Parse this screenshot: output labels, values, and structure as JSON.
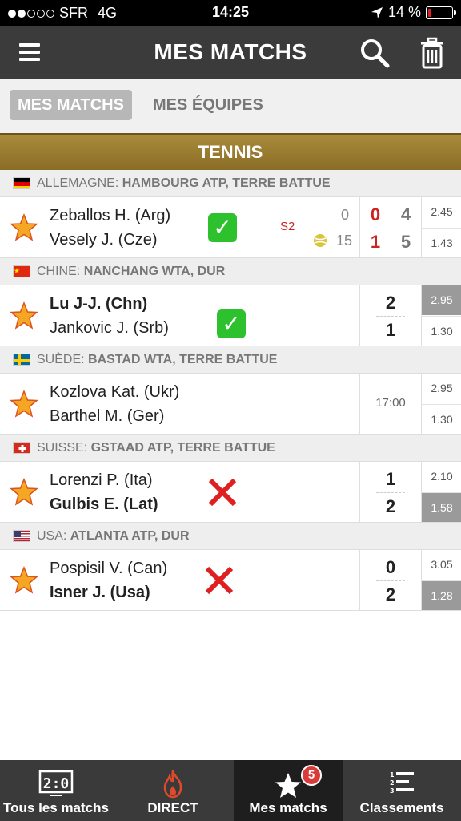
{
  "status_bar": {
    "carrier": "SFR",
    "network": "4G",
    "time": "14:25",
    "battery": "14 %"
  },
  "header": {
    "title": "MES MATCHS",
    "menu_icon": "hamburger-icon",
    "search_icon": "search-icon",
    "trash_icon": "trash-icon"
  },
  "tabs": [
    {
      "label": "MES MATCHS",
      "active": true
    },
    {
      "label": "MES ÉQUIPES",
      "active": false
    }
  ],
  "sport": "TENNIS",
  "leagues": [
    {
      "country": "ALLEMAGNE:",
      "competition": "HAMBOURG ATP, TERRE BATTUE",
      "match": {
        "player1": "Zeballos H. (Arg)",
        "player2": "Vesely J. (Cze)",
        "status": "check",
        "set_label": "S2",
        "game_points": [
          "0",
          "15"
        ],
        "current_set": [
          "0",
          "1"
        ],
        "sets": [
          "4",
          "5"
        ],
        "odds": [
          "2.45",
          "1.43"
        ]
      }
    },
    {
      "country": "CHINE:",
      "competition": "NANCHANG WTA, DUR",
      "match": {
        "player1": "Lu J-J. (Chn)",
        "player2": "Jankovic J. (Srb)",
        "status": "check",
        "score": [
          "2",
          "1"
        ],
        "odds": [
          "2.95",
          "1.30"
        ]
      }
    },
    {
      "country": "SUÈDE:",
      "competition": "BASTAD WTA, TERRE BATTUE",
      "match": {
        "player1": "Kozlova Kat. (Ukr)",
        "player2": "Barthel M. (Ger)",
        "time": "17:00",
        "odds": [
          "2.95",
          "1.30"
        ]
      }
    },
    {
      "country": "SUISSE:",
      "competition": "GSTAAD ATP, TERRE BATTUE",
      "match": {
        "player1": "Lorenzi P. (Ita)",
        "player2": "Gulbis E. (Lat)",
        "status": "cross",
        "score": [
          "1",
          "2"
        ],
        "odds": [
          "2.10",
          "1.58"
        ]
      }
    },
    {
      "country": "USA:",
      "competition": "ATLANTA ATP, DUR",
      "match": {
        "player1": "Pospisil V. (Can)",
        "player2": "Isner J. (Usa)",
        "status": "cross",
        "score": [
          "0",
          "2"
        ],
        "odds": [
          "3.05",
          "1.28"
        ]
      }
    }
  ],
  "tabbar": [
    {
      "label": "Tous les matchs",
      "icon": "scoreboard-icon"
    },
    {
      "label": "DIRECT",
      "icon": "flame-icon"
    },
    {
      "label": "Mes matchs",
      "icon": "star-icon",
      "badge": "5",
      "active": true
    },
    {
      "label": "Classements",
      "icon": "ranking-list-icon"
    }
  ],
  "colors": {
    "header_bg": "#3b3b3b",
    "sport_band": "#a98b3c",
    "star": "#f5a623",
    "check": "#2ec12e",
    "cross": "#e02020",
    "badge": "#d93a3a"
  }
}
